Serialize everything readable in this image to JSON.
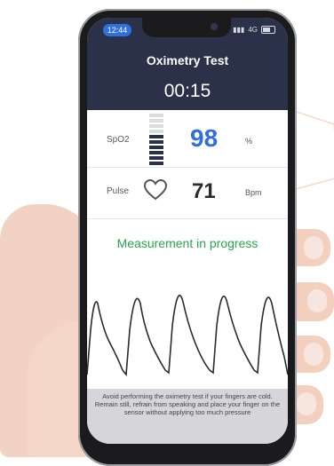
{
  "status_bar": {
    "time": "12:44",
    "network": "4G"
  },
  "header": {
    "title": "Oximetry Test",
    "timer": "00:15"
  },
  "spo2": {
    "label": "SpO2",
    "value": "98",
    "unit": "%",
    "level_fraction": 0.6,
    "accent": "#2f6fe0"
  },
  "pulse": {
    "label": "Pulse",
    "value": "71",
    "unit": "Bpm",
    "icon": "heart-icon"
  },
  "measurement": {
    "status": "Measurement in progress",
    "color": "#27a74a"
  },
  "notice": {
    "line1": "Avoid performing the oximetry test if your fingers are cold.",
    "line2": "Remain still, refrain from speaking and place your finger on the sensor without applying too much pressure"
  }
}
